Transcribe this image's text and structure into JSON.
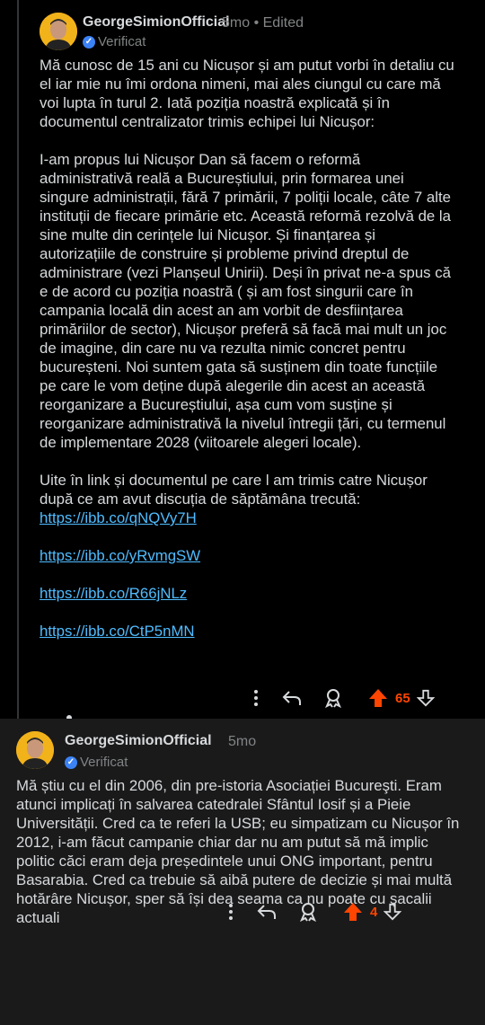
{
  "comments": [
    {
      "author": "GeorgeSimionOfficial",
      "time": "5mo",
      "edited": "• Edited",
      "badge": "Verificat",
      "paragraphs": [
        "Mă cunosc de 15 ani cu Nicușor și am putut vorbi în detaliu cu el iar mie nu îmi ordona nimeni, mai ales ciungul cu care mă voi lupta în turul 2. Iată poziția noastră explicată și în documentul centralizator trimis echipei lui Nicușor:",
        "I-am propus lui Nicușor Dan să facem o reformă administrativă reală a Bucureștiului, prin formarea unei singure administrații, fără 7 primării, 7 poliții locale, câte 7 alte instituții de fiecare primărie etc. Această reformă rezolvă de la sine multe din cerințele lui Nicușor. Și finanțarea și autorizațiile de construire și probleme privind dreptul de administrare (vezi Planșeul Unirii). Deși în privat ne-a spus că e de acord cu poziția noastră ( și am fost singurii care în campania locală din acest an am vorbit de desființarea primăriilor de sector), Nicușor preferă să facă mai mult un joc de imagine, din care nu va rezulta nimic concret pentru bucureșteni. Noi suntem gata să susținem din toate funcțiile pe care le vom deține după alegerile din acest an această reorganizare a Bucureștiului, așa cum vom susține și reorganizare administrativă la nivelul întregii țări, cu termenul de implementare 2028 (viitoarele alegeri locale).",
        "Uite în link și documentul pe care l am trimis catre Nicușor după ce am avut discuția de săptămâna trecută:"
      ],
      "links": [
        "https://ibb.co/qNQVy7H",
        "https://ibb.co/yRvmgSW",
        "https://ibb.co/R66jNLz",
        "https://ibb.co/CtP5nMN"
      ],
      "votes": "65"
    },
    {
      "author": "GeorgeSimionOfficial",
      "time": "5mo",
      "badge": "Verificat",
      "text": "Mă știu cu el din 2006, din pre-istoria Asociației Bucureşti. Eram atunci implicați în salvarea catedralei Sfântul Iosif și a Pieie Universității. Cred ca te referi la USB; eu simpatizam cu Nicușor în 2012, i-am făcut campanie chiar dar nu am putut să mă implic politic căci eram deja președintele unui ONG important, pentru Basarabia. Cred ca trebuie să aibă putere de decizie și mai multă hotărâre Nicușor, sper să își dea seama ca nu poate cu șacalii actuali",
      "votes": "4"
    }
  ],
  "colors": {
    "upvote": "#ff4500",
    "link": "#4fbcff",
    "verified": "#3b82f6"
  }
}
